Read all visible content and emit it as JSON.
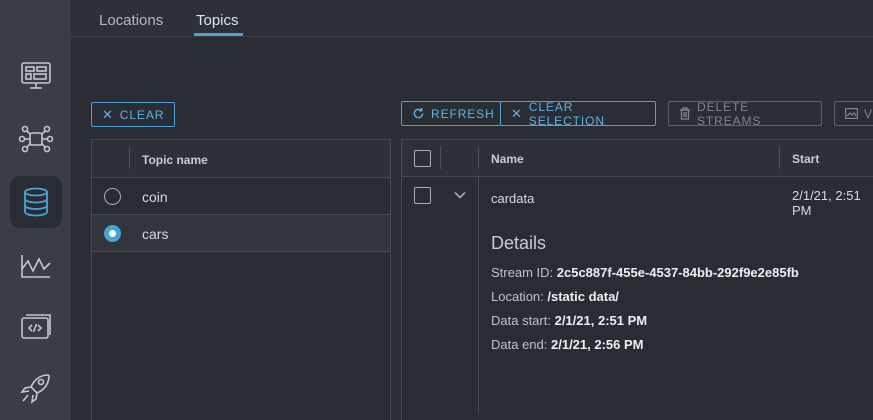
{
  "tabs": [
    {
      "label": "Locations",
      "active": false
    },
    {
      "label": "Topics",
      "active": true
    }
  ],
  "sidebar": [
    {
      "icon": "dashboard-icon",
      "active": false
    },
    {
      "icon": "network-icon",
      "active": false
    },
    {
      "icon": "database-icon",
      "active": true
    },
    {
      "icon": "waveform-icon",
      "active": false
    },
    {
      "icon": "code-window-icon",
      "active": false
    },
    {
      "icon": "rocket-icon",
      "active": false
    }
  ],
  "toolbar": {
    "clear_label": "CLEAR",
    "refresh_label": "REFRESH",
    "clear_selection_label": "CLEAR SELECTION",
    "delete_streams_label": "DELETE STREAMS",
    "partial_label": "V"
  },
  "topics": {
    "header": "Topic name",
    "rows": [
      {
        "name": "coin",
        "selected": false
      },
      {
        "name": "cars",
        "selected": true
      }
    ]
  },
  "streams": {
    "columns": [
      "Name",
      "Start"
    ],
    "rows": [
      {
        "name": "cardata",
        "start": "2/1/21, 2:51 PM",
        "expanded": true,
        "details": {
          "title": "Details",
          "stream_id_label": "Stream ID:",
          "stream_id": "2c5c887f-455e-4537-84bb-292f9e2e85fb",
          "location_label": "Location:",
          "location": "/static data/",
          "data_start_label": "Data start:",
          "data_start": "2/1/21, 2:51 PM",
          "data_end_label": "Data end:",
          "data_end": "2/1/21, 2:56 PM"
        }
      }
    ]
  },
  "colors": {
    "accent": "#4aa3d6",
    "background": "#2b2d34",
    "sidebar": "#3a3d45"
  }
}
